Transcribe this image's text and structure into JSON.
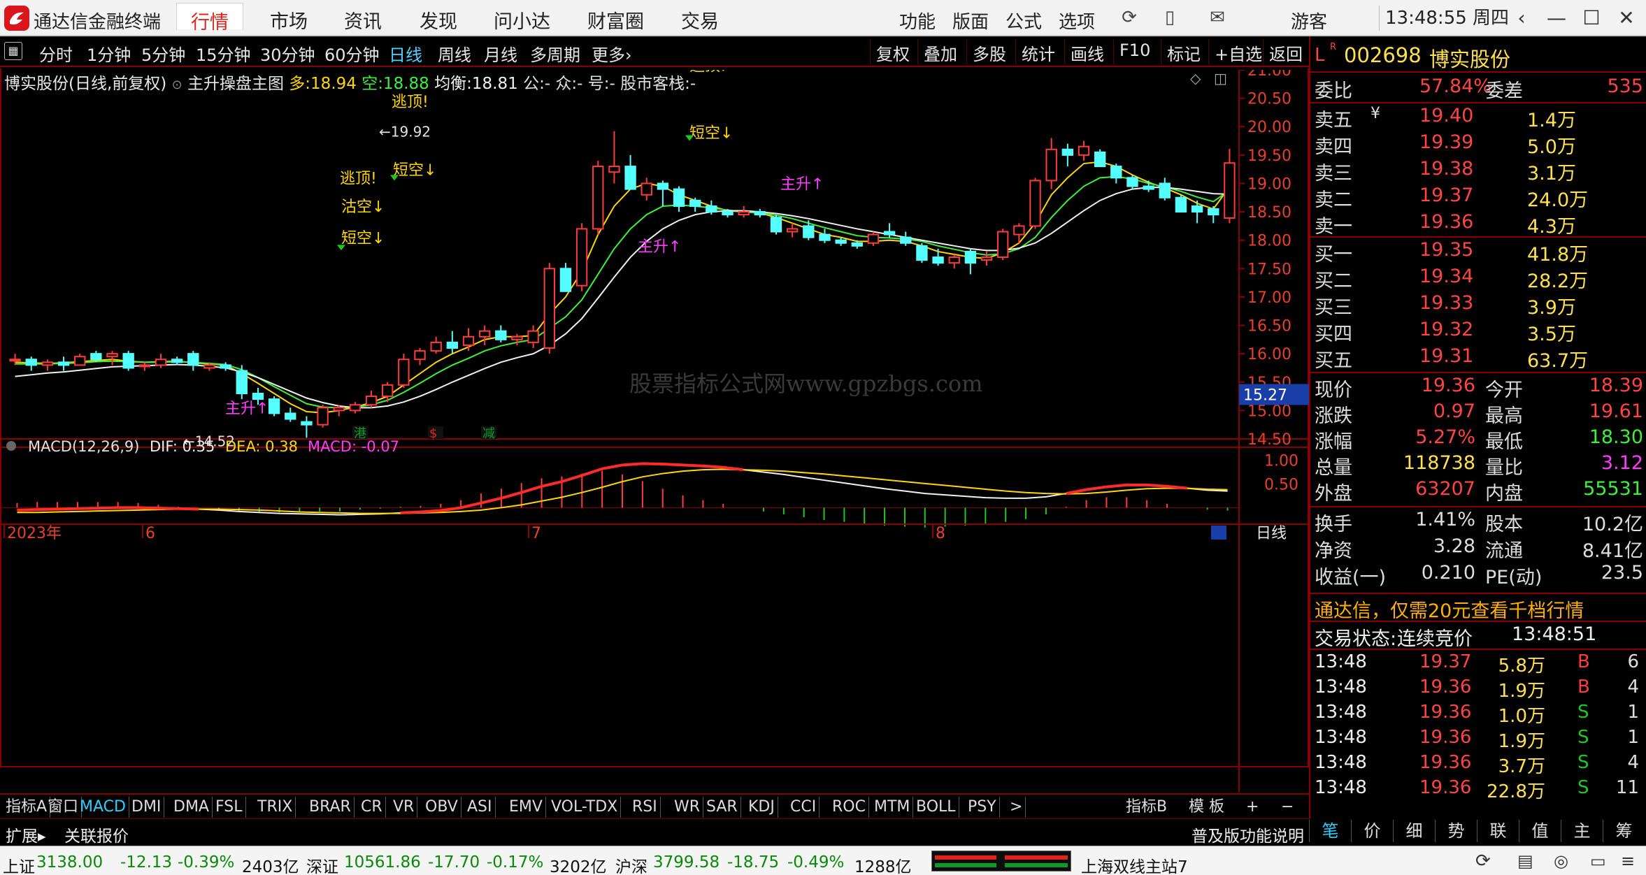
{
  "app": {
    "name": "通达信金融终端",
    "logo_icon": "tdx-logo-icon"
  },
  "menu": {
    "tabs": [
      "行情",
      "市场",
      "资讯",
      "发现",
      "问小达",
      "财富圈",
      "交易"
    ],
    "active_tab": "行情",
    "right": [
      "功能",
      "版面",
      "公式",
      "选项"
    ],
    "user": "游客",
    "clock": "13:48:55 周四"
  },
  "periods": [
    "分时",
    "1分钟",
    "5分钟",
    "15分钟",
    "30分钟",
    "60分钟",
    "日线",
    "周线",
    "月线",
    "多周期",
    "更多›"
  ],
  "active_period": "日线",
  "tools": [
    "复权",
    "叠加",
    "多股",
    "统计",
    "画线",
    "F10",
    "标记",
    "+自选",
    "返回"
  ],
  "chart_header": {
    "stock": "博实股份(日线,前复权)",
    "indicator": "主升操盘主图",
    "duo_label": "多:",
    "duo": "18.94",
    "kong_label": "空:",
    "kong": "18.88",
    "jh_label": "均衡:",
    "jh": "18.81",
    "rest": "公:- 众:- 号:- 股市客栈:-"
  },
  "chart_data": {
    "type": "candlestick",
    "y_axis": {
      "min": 14.5,
      "max": 21.0,
      "ticks": [
        "21.00",
        "20.50",
        "20.00",
        "19.50",
        "19.00",
        "18.50",
        "18.00",
        "17.50",
        "17.00",
        "16.50",
        "16.00",
        "15.50",
        "15.00",
        "14.50"
      ]
    },
    "last_price_tag": "15.27",
    "candles": [
      [
        15.9,
        16.0,
        15.8,
        15.9
      ],
      [
        15.9,
        15.95,
        15.7,
        15.8
      ],
      [
        15.8,
        15.9,
        15.7,
        15.85
      ],
      [
        15.85,
        15.95,
        15.7,
        15.8
      ],
      [
        15.8,
        16.0,
        15.8,
        15.95
      ],
      [
        16.0,
        16.05,
        15.85,
        15.9
      ],
      [
        15.95,
        16.05,
        15.8,
        16.0
      ],
      [
        16.0,
        16.05,
        15.7,
        15.75
      ],
      [
        15.8,
        15.85,
        15.7,
        15.8
      ],
      [
        15.8,
        16.0,
        15.75,
        15.9
      ],
      [
        15.9,
        15.95,
        15.8,
        15.85
      ],
      [
        16.0,
        16.05,
        15.7,
        15.8
      ],
      [
        15.75,
        15.85,
        15.7,
        15.8
      ],
      [
        15.8,
        15.85,
        15.7,
        15.75
      ],
      [
        15.7,
        15.8,
        15.2,
        15.3
      ],
      [
        15.3,
        15.4,
        15.1,
        15.2
      ],
      [
        15.2,
        15.25,
        14.9,
        14.95
      ],
      [
        14.95,
        15.05,
        14.8,
        14.85
      ],
      [
        14.8,
        14.9,
        14.52,
        14.75
      ],
      [
        14.75,
        15.1,
        14.7,
        15.05
      ],
      [
        15.0,
        15.1,
        14.9,
        15.05
      ],
      [
        15.0,
        15.15,
        14.95,
        15.1
      ],
      [
        15.1,
        15.35,
        15.05,
        15.25
      ],
      [
        15.25,
        15.5,
        15.15,
        15.45
      ],
      [
        15.45,
        16.0,
        15.4,
        15.9
      ],
      [
        15.9,
        16.1,
        15.8,
        16.05
      ],
      [
        16.05,
        16.3,
        16.0,
        16.2
      ],
      [
        16.2,
        16.4,
        16.0,
        16.1
      ],
      [
        16.15,
        16.45,
        16.05,
        16.3
      ],
      [
        16.3,
        16.5,
        16.15,
        16.4
      ],
      [
        16.4,
        16.5,
        16.2,
        16.25
      ],
      [
        16.25,
        16.35,
        16.15,
        16.3
      ],
      [
        16.2,
        16.5,
        16.1,
        16.4
      ],
      [
        16.1,
        17.6,
        16.0,
        17.5
      ],
      [
        17.5,
        17.6,
        17.1,
        17.1
      ],
      [
        17.2,
        18.3,
        17.1,
        18.2
      ],
      [
        18.2,
        19.4,
        18.1,
        19.3
      ],
      [
        19.2,
        19.92,
        19.0,
        19.3
      ],
      [
        19.3,
        19.5,
        18.9,
        18.9
      ],
      [
        18.8,
        19.1,
        18.7,
        19.0
      ],
      [
        19.0,
        19.05,
        18.6,
        18.9
      ],
      [
        18.9,
        18.95,
        18.5,
        18.6
      ],
      [
        18.7,
        18.75,
        18.5,
        18.6
      ],
      [
        18.6,
        18.7,
        18.45,
        18.5
      ],
      [
        18.5,
        18.55,
        18.4,
        18.45
      ],
      [
        18.45,
        18.6,
        18.4,
        18.5
      ],
      [
        18.5,
        18.55,
        18.4,
        18.45
      ],
      [
        18.4,
        18.45,
        18.1,
        18.15
      ],
      [
        18.15,
        18.3,
        18.05,
        18.2
      ],
      [
        18.25,
        18.35,
        18.0,
        18.05
      ],
      [
        18.1,
        18.2,
        17.95,
        18.0
      ],
      [
        18.0,
        18.05,
        17.9,
        17.95
      ],
      [
        17.95,
        18.0,
        17.85,
        17.9
      ],
      [
        17.95,
        18.15,
        17.9,
        18.1
      ],
      [
        18.15,
        18.3,
        18.05,
        18.1
      ],
      [
        18.05,
        18.15,
        17.9,
        17.95
      ],
      [
        17.9,
        17.95,
        17.6,
        17.65
      ],
      [
        17.7,
        17.85,
        17.55,
        17.6
      ],
      [
        17.6,
        17.75,
        17.5,
        17.7
      ],
      [
        17.8,
        17.85,
        17.4,
        17.6
      ],
      [
        17.65,
        17.8,
        17.55,
        17.7
      ],
      [
        17.7,
        18.2,
        17.65,
        18.15
      ],
      [
        18.1,
        18.3,
        17.95,
        18.25
      ],
      [
        18.25,
        19.1,
        18.2,
        19.05
      ],
      [
        19.05,
        19.8,
        18.9,
        19.6
      ],
      [
        19.6,
        19.7,
        19.3,
        19.5
      ],
      [
        19.5,
        19.75,
        19.4,
        19.65
      ],
      [
        19.55,
        19.6,
        19.3,
        19.3
      ],
      [
        19.3,
        19.35,
        19.0,
        19.1
      ],
      [
        19.1,
        19.15,
        18.9,
        18.95
      ],
      [
        18.95,
        19.05,
        18.85,
        18.9
      ],
      [
        19.0,
        19.1,
        18.7,
        18.75
      ],
      [
        18.75,
        18.8,
        18.5,
        18.5
      ],
      [
        18.6,
        18.7,
        18.3,
        18.5
      ],
      [
        18.55,
        18.6,
        18.3,
        18.45
      ],
      [
        18.39,
        19.61,
        18.3,
        19.36
      ]
    ],
    "series": [
      {
        "name": "多",
        "values": [
          15.85,
          15.84,
          15.83,
          15.84,
          15.86,
          15.88,
          15.9,
          15.87,
          15.85,
          15.86,
          15.87,
          15.84,
          15.82,
          15.8,
          15.65,
          15.48,
          15.3,
          15.12,
          14.98,
          14.96,
          15.0,
          15.06,
          15.14,
          15.25,
          15.45,
          15.65,
          15.85,
          16.0,
          16.12,
          16.25,
          16.3,
          16.3,
          16.32,
          16.7,
          17.0,
          17.45,
          18.1,
          18.6,
          18.9,
          19.0,
          18.95,
          18.8,
          18.7,
          18.6,
          18.52,
          18.5,
          18.48,
          18.4,
          18.3,
          18.2,
          18.1,
          18.05,
          17.98,
          17.98,
          18.0,
          17.98,
          17.9,
          17.8,
          17.75,
          17.7,
          17.68,
          17.78,
          17.95,
          18.3,
          18.8,
          19.1,
          19.35,
          19.38,
          19.3,
          19.15,
          19.02,
          18.92,
          18.8,
          18.65,
          18.55,
          18.94
        ]
      },
      {
        "name": "空",
        "values": [
          15.82,
          15.82,
          15.82,
          15.83,
          15.84,
          15.86,
          15.87,
          15.86,
          15.85,
          15.85,
          15.86,
          15.85,
          15.83,
          15.81,
          15.72,
          15.58,
          15.42,
          15.27,
          15.12,
          15.06,
          15.05,
          15.06,
          15.1,
          15.18,
          15.32,
          15.48,
          15.65,
          15.8,
          15.92,
          16.05,
          16.14,
          16.2,
          16.25,
          16.45,
          16.65,
          16.95,
          17.4,
          17.85,
          18.2,
          18.45,
          18.6,
          18.62,
          18.6,
          18.57,
          18.53,
          18.5,
          18.48,
          18.44,
          18.38,
          18.3,
          18.22,
          18.15,
          18.08,
          18.05,
          18.04,
          18.02,
          17.98,
          17.9,
          17.84,
          17.78,
          17.74,
          17.76,
          17.85,
          18.05,
          18.4,
          18.7,
          18.95,
          19.1,
          19.12,
          19.08,
          19.0,
          18.94,
          18.86,
          18.76,
          18.68,
          18.88
        ]
      },
      {
        "name": "均衡",
        "values": [
          15.6,
          15.63,
          15.66,
          15.68,
          15.71,
          15.74,
          15.77,
          15.78,
          15.79,
          15.8,
          15.81,
          15.8,
          15.78,
          15.75,
          15.68,
          15.58,
          15.46,
          15.34,
          15.22,
          15.14,
          15.08,
          15.05,
          15.05,
          15.08,
          15.15,
          15.25,
          15.37,
          15.5,
          15.62,
          15.74,
          15.85,
          15.93,
          16.0,
          16.15,
          16.35,
          16.62,
          16.98,
          17.35,
          17.7,
          17.98,
          18.2,
          18.35,
          18.45,
          18.5,
          18.52,
          18.52,
          18.5,
          18.47,
          18.43,
          18.38,
          18.32,
          18.26,
          18.2,
          18.15,
          18.1,
          18.05,
          18.0,
          17.95,
          17.9,
          17.85,
          17.82,
          17.82,
          17.86,
          17.95,
          18.12,
          18.32,
          18.52,
          18.7,
          18.82,
          18.9,
          18.93,
          18.93,
          18.9,
          18.86,
          18.82,
          18.81
        ]
      }
    ],
    "annotations": [
      {
        "text": "←14.52",
        "color": "#e0e0e0"
      },
      {
        "text": "←19.92",
        "color": "#e0e0e0"
      },
      {
        "text": "主升↑",
        "color": "#ff3cff"
      },
      {
        "text": "主升↑",
        "color": "#ff3cff"
      },
      {
        "text": "主升↑",
        "color": "#ff3cff"
      },
      {
        "text": "逃顶!",
        "color": "#ffd700"
      },
      {
        "text": "逃顶!",
        "color": "#ffd700"
      },
      {
        "text": "逃顶!",
        "color": "#ffd700"
      },
      {
        "text": "沽空↓",
        "color": "#ffd700"
      },
      {
        "text": "短空↓",
        "color": "#ffd700"
      },
      {
        "text": "短空↓",
        "color": "#ffd700"
      },
      {
        "text": "短空↓",
        "color": "#ffd700"
      }
    ],
    "event_badges": [
      {
        "text": "港",
        "color": "#0c9a2c"
      },
      {
        "text": "$",
        "color": "#e0241d"
      },
      {
        "text": "减",
        "color": "#0c9a2c"
      }
    ],
    "watermark": "股票指标公式网www.gpzbgs.com",
    "macd": {
      "title": "MACD(12,26,9)",
      "dif_label": "DIF:",
      "dif": "0.35",
      "dea_label": "DEA:",
      "dea": "0.38",
      "macd_label": "MACD:",
      "macd": "-0.07",
      "ticks": [
        "1.00",
        "0.50"
      ],
      "dif_values": [
        -0.05,
        -0.04,
        -0.03,
        -0.02,
        -0.01,
        0.0,
        0.0,
        -0.01,
        -0.02,
        -0.03,
        -0.05,
        -0.08,
        -0.1,
        -0.12,
        -0.13,
        -0.14,
        -0.15,
        -0.14,
        -0.13,
        -0.11,
        -0.09,
        -0.06,
        0.0,
        0.1,
        0.2,
        0.32,
        0.45,
        0.55,
        0.68,
        0.82,
        0.9,
        0.93,
        0.92,
        0.9,
        0.88,
        0.85,
        0.8,
        0.75,
        0.7,
        0.64,
        0.58,
        0.52,
        0.46,
        0.4,
        0.35,
        0.3,
        0.27,
        0.24,
        0.21,
        0.2,
        0.2,
        0.23,
        0.3,
        0.38,
        0.44,
        0.48,
        0.48,
        0.45,
        0.41,
        0.37,
        0.35
      ],
      "dea_values": [
        -0.1,
        -0.1,
        -0.09,
        -0.08,
        -0.07,
        -0.06,
        -0.05,
        -0.04,
        -0.03,
        -0.03,
        -0.03,
        -0.04,
        -0.05,
        -0.07,
        -0.09,
        -0.1,
        -0.11,
        -0.12,
        -0.12,
        -0.12,
        -0.11,
        -0.1,
        -0.08,
        -0.05,
        0.0,
        0.06,
        0.14,
        0.22,
        0.32,
        0.43,
        0.55,
        0.65,
        0.72,
        0.77,
        0.8,
        0.81,
        0.8,
        0.79,
        0.77,
        0.74,
        0.71,
        0.67,
        0.63,
        0.59,
        0.55,
        0.51,
        0.47,
        0.43,
        0.39,
        0.35,
        0.32,
        0.3,
        0.29,
        0.3,
        0.33,
        0.37,
        0.4,
        0.41,
        0.41,
        0.39,
        0.38
      ]
    },
    "x_labels": [
      "2023年",
      "6",
      "7",
      "8"
    ],
    "period_label": "日线"
  },
  "indicator_tabs": [
    "指标A",
    "窗口",
    "MACD",
    "DMI",
    "DMA",
    "FSL",
    "TRIX",
    "BRAR",
    "CR",
    "VR",
    "OBV",
    "ASI",
    "EMV",
    "VOL-TDX",
    "RSI",
    "WR",
    "SAR",
    "KDJ",
    "CCI",
    "ROC",
    "MTM",
    "BOLL",
    "PSY",
    ">"
  ],
  "indicator_active": "MACD",
  "indicator_right": [
    "指标B",
    "模 板",
    "+",
    "−"
  ],
  "ext_bar": [
    "扩展▸",
    "关联报价"
  ],
  "ext_right": "普及版功能说明",
  "panel": {
    "code": "002698",
    "name": "博实股份",
    "r_mark": "R",
    "l_mark": "L",
    "weibi_label": "委比",
    "weibi": "57.84%",
    "weicha_label": "委差",
    "weicha": "535",
    "asks": [
      {
        "label": "卖五",
        "price": "19.40",
        "vol": "1.4万"
      },
      {
        "label": "卖四",
        "price": "19.39",
        "vol": "5.0万"
      },
      {
        "label": "卖三",
        "price": "19.38",
        "vol": "3.1万"
      },
      {
        "label": "卖二",
        "price": "19.37",
        "vol": "24.0万"
      },
      {
        "label": "卖一",
        "price": "19.36",
        "vol": "4.3万"
      }
    ],
    "bids": [
      {
        "label": "买一",
        "price": "19.35",
        "vol": "41.8万"
      },
      {
        "label": "买二",
        "price": "19.34",
        "vol": "28.2万"
      },
      {
        "label": "买三",
        "price": "19.33",
        "vol": "3.9万"
      },
      {
        "label": "买四",
        "price": "19.32",
        "vol": "3.5万"
      },
      {
        "label": "买五",
        "price": "19.31",
        "vol": "63.7万"
      }
    ],
    "quote": [
      {
        "l": "现价",
        "v": "19.36",
        "c": "#ff4444",
        "l2": "今开",
        "v2": "18.39",
        "c2": "#ff4444"
      },
      {
        "l": "涨跌",
        "v": "0.97",
        "c": "#ff4444",
        "l2": "最高",
        "v2": "19.61",
        "c2": "#ff4444"
      },
      {
        "l": "涨幅",
        "v": "5.27%",
        "c": "#ff4444",
        "l2": "最低",
        "v2": "18.30",
        "c2": "#3cf03c"
      },
      {
        "l": "总量",
        "v": "118738",
        "c": "#ffe14d",
        "l2": "量比",
        "v2": "3.12",
        "c2": "#ff3cff"
      },
      {
        "l": "外盘",
        "v": "63207",
        "c": "#ff4444",
        "l2": "内盘",
        "v2": "55531",
        "c2": "#3cf03c"
      }
    ],
    "fund": [
      {
        "l": "换手",
        "v": "1.41%",
        "l2": "股本",
        "v2": "10.2亿"
      },
      {
        "l": "净资",
        "v": "3.28",
        "l2": "流通",
        "v2": "8.41亿"
      },
      {
        "l": "收益(一)",
        "v": "0.210",
        "l2": "PE(动)",
        "v2": "23.5"
      }
    ],
    "promo": "通达信，仅需20元查看千档行情",
    "trade_status_label": "交易状态:",
    "trade_status": "连续竞价",
    "trade_time": "13:48:51",
    "ticks": [
      {
        "t": "13:48",
        "p": "19.37",
        "v": "5.8万",
        "bs": "B",
        "n": "6"
      },
      {
        "t": "13:48",
        "p": "19.36",
        "v": "1.9万",
        "bs": "B",
        "n": "4"
      },
      {
        "t": "13:48",
        "p": "19.36",
        "v": "1.0万",
        "bs": "S",
        "n": "1"
      },
      {
        "t": "13:48",
        "p": "19.36",
        "v": "1.9万",
        "bs": "S",
        "n": "1"
      },
      {
        "t": "13:48",
        "p": "19.36",
        "v": "3.7万",
        "bs": "S",
        "n": "4"
      },
      {
        "t": "13:48",
        "p": "19.36",
        "v": "22.8万",
        "bs": "S",
        "n": "11"
      }
    ],
    "bottom_tabs": [
      "笔",
      "价",
      "细",
      "势",
      "联",
      "值",
      "主",
      "筹"
    ]
  },
  "status": {
    "sh_label": "上证",
    "sh": "3138.00",
    "sh_chg": "-12.13",
    "sh_pct": "-0.39%",
    "sh_amt": "2403亿",
    "sz_label": "深证",
    "sz": "10561.86",
    "sz_chg": "-17.70",
    "sz_pct": "-0.17%",
    "sz_amt": "3202亿",
    "hs_label": "沪深",
    "hs": "3799.58",
    "hs_chg": "-18.75",
    "hs_pct": "-0.49%",
    "hs_amt": "1288亿",
    "server": "上海双线主站7"
  }
}
